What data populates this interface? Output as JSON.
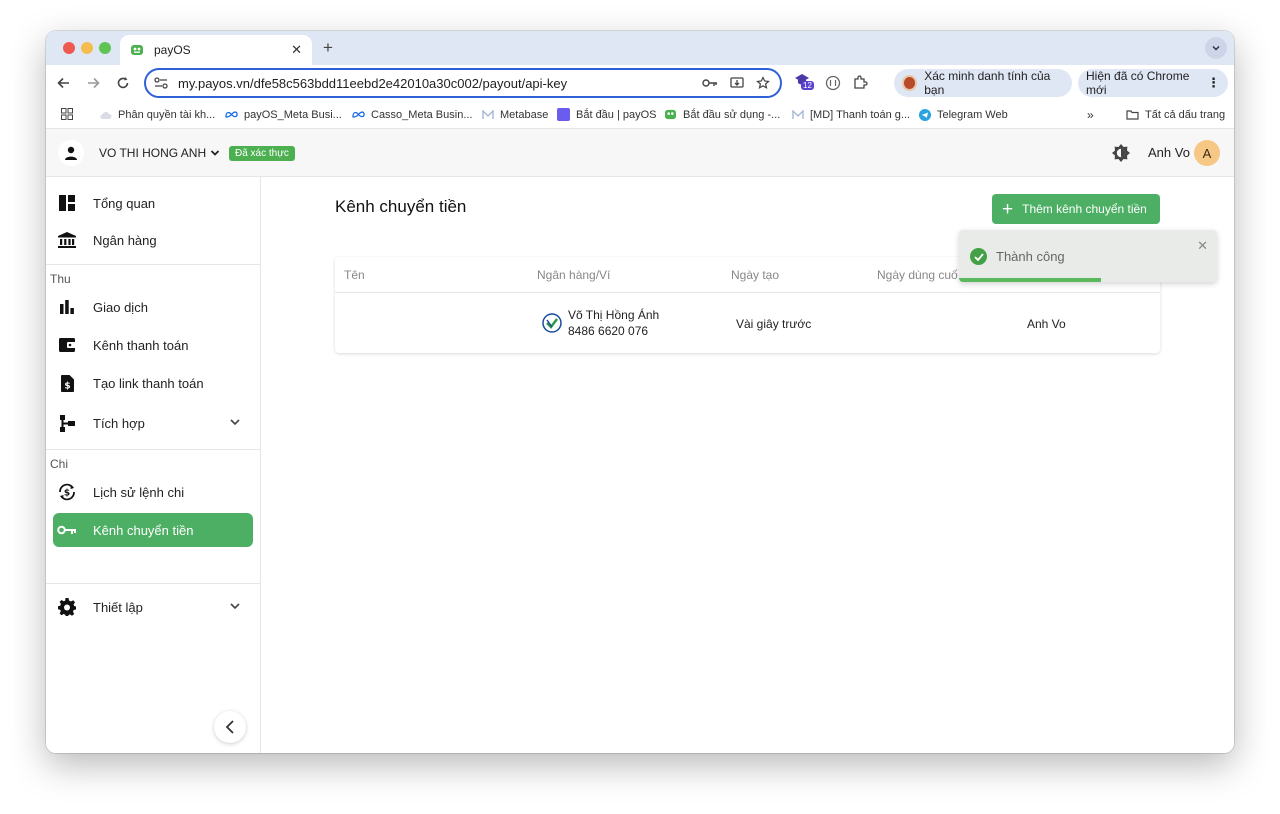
{
  "browser": {
    "tab_title": "payOS",
    "url": "my.payos.vn/dfe58c563bdd11eebd2e42010a30c002/payout/api-key",
    "extension_badge": "12",
    "verify_pill": "Xác minh danh tính của bạn",
    "update_pill": "Hiện đã có Chrome mới",
    "bookmarks": [
      "Phân quyền tài kh...",
      "payOS_Meta Busi...",
      "Casso_Meta Busin...",
      "Metabase",
      "Bắt đầu | payOS",
      "Bắt đầu sử dụng -...",
      "[MD] Thanh toán g...",
      "Telegram Web"
    ],
    "all_bookmarks": "Tất cả dấu trang"
  },
  "header": {
    "org_name": "VO THI HONG ANH",
    "verified": "Đã xác thực",
    "user_name": "Anh Vo",
    "avatar_letter": "A"
  },
  "sidebar": {
    "items_top": [
      "Tổng quan",
      "Ngân hàng"
    ],
    "group_income": "Thu",
    "items_income": [
      "Giao dịch",
      "Kênh thanh toán",
      "Tạo link thanh toán",
      "Tích hợp"
    ],
    "group_expense": "Chi",
    "items_expense": [
      "Lịch sử lệnh chi",
      "Kênh chuyển tiền"
    ],
    "settings": "Thiết lập"
  },
  "main": {
    "title": "Kênh chuyển tiền",
    "add_button": "Thêm kênh chuyển tiền",
    "columns": [
      "Tên",
      "Ngân hàng/Ví",
      "Ngày tạo",
      "Ngày dùng cuố"
    ],
    "rows": [
      {
        "name": "",
        "bank_holder": "Võ Thị Hồng Ánh",
        "account": "8486 6620 076",
        "created": "Vài giây trước",
        "creator": "Anh Vo"
      }
    ]
  },
  "toast": {
    "message": "Thành công",
    "progress": 0.55
  },
  "colors": {
    "accent_green": "#4caf64",
    "browser_blue": "#2e60d8"
  }
}
